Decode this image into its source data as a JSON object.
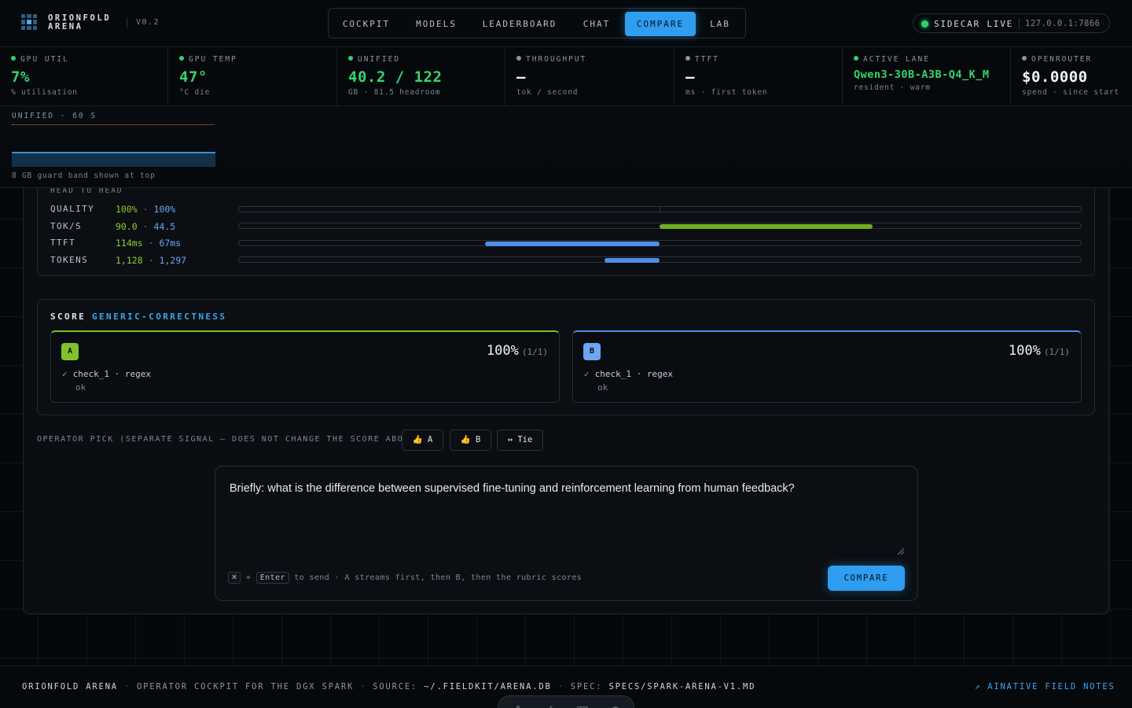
{
  "header": {
    "brand_line1": "ORIONFOLD",
    "brand_line2": "ARENA",
    "version": "V0.2",
    "nav": [
      {
        "label": "COCKPIT",
        "active": false
      },
      {
        "label": "MODELS",
        "active": false
      },
      {
        "label": "LEADERBOARD",
        "active": false
      },
      {
        "label": "CHAT",
        "active": false
      },
      {
        "label": "COMPARE",
        "active": true
      },
      {
        "label": "LAB",
        "active": false
      }
    ],
    "sidecar_label": "SIDECAR LIVE",
    "sidecar_addr": "127.0.0.1:7866"
  },
  "metrics": [
    {
      "label": "GPU UTIL",
      "value": "7%",
      "sub": "% utilisation",
      "dot": "#2fd36a"
    },
    {
      "label": "GPU TEMP",
      "value": "47°",
      "sub": "°C die",
      "dot": "#2fd36a"
    },
    {
      "label": "UNIFIED",
      "value": "40.2 / 122",
      "sub": "GB · 81.5 headroom",
      "dot": "#2fd36a"
    },
    {
      "label": "THROUGHPUT",
      "value": "—",
      "sub": "tok / second",
      "dot": "#8a949e"
    },
    {
      "label": "TTFT",
      "value": "—",
      "sub": "ms · first token",
      "dot": "#8a949e"
    },
    {
      "label": "ACTIVE LANE",
      "value": "Qwen3-30B-A3B-Q4_K_M",
      "sub": "resident · warm",
      "dot": "#2fd36a"
    },
    {
      "label": "OPENROUTER",
      "value": "$0.0000",
      "sub": "spend · since start",
      "dot": "#8a949e"
    }
  ],
  "unified_strip": {
    "label": "UNIFIED · 60 S",
    "note": "8 GB guard band shown at top"
  },
  "head_to_head": {
    "title": "HEAD TO HEAD",
    "rows": [
      {
        "label": "QUALITY",
        "a": "100%",
        "b": "100%"
      },
      {
        "label": "TOK/S",
        "a": "90.0",
        "b": "44.5"
      },
      {
        "label": "TTFT",
        "a": "114ms",
        "b": "67ms"
      },
      {
        "label": "TOKENS",
        "a": "1,128",
        "b": "1,297"
      }
    ],
    "separator": "·"
  },
  "score": {
    "title": "SCORE",
    "rubric": "GENERIC-CORRECTNESS",
    "cards": [
      {
        "badge": "A",
        "pct": "100%",
        "frac": "(1/1)",
        "check": "check_1 · regex",
        "result": "ok"
      },
      {
        "badge": "B",
        "pct": "100%",
        "frac": "(1/1)",
        "check": "check_1 · regex",
        "result": "ok"
      }
    ]
  },
  "operator_pick": {
    "label": "OPERATOR PICK (SEPARATE SIGNAL — DOES NOT CHANGE THE SCORE ABOVE)",
    "buttons": [
      "👍 A",
      "👍 B",
      "↔ Tie"
    ]
  },
  "composer": {
    "prompt": "Briefly: what is the difference between supervised fine-tuning and reinforcement learning from human feedback?",
    "hint_key1": "⌘",
    "hint_plus": "+",
    "hint_key2": "Enter",
    "hint_text": "to send · A streams first, then B, then the rubric scores",
    "button": "COMPARE"
  },
  "footer": {
    "brand": "ORIONFOLD ARENA",
    "tagline": "OPERATOR COCKPIT FOR THE DGX SPARK",
    "source_label": "SOURCE:",
    "source_value": "~/.FIELDKIT/ARENA.DB",
    "spec_label": "SPEC:",
    "spec_value": "SPECS/SPARK-ARENA-V1.MD",
    "link": "↗ AINATIVE FIELD NOTES"
  }
}
